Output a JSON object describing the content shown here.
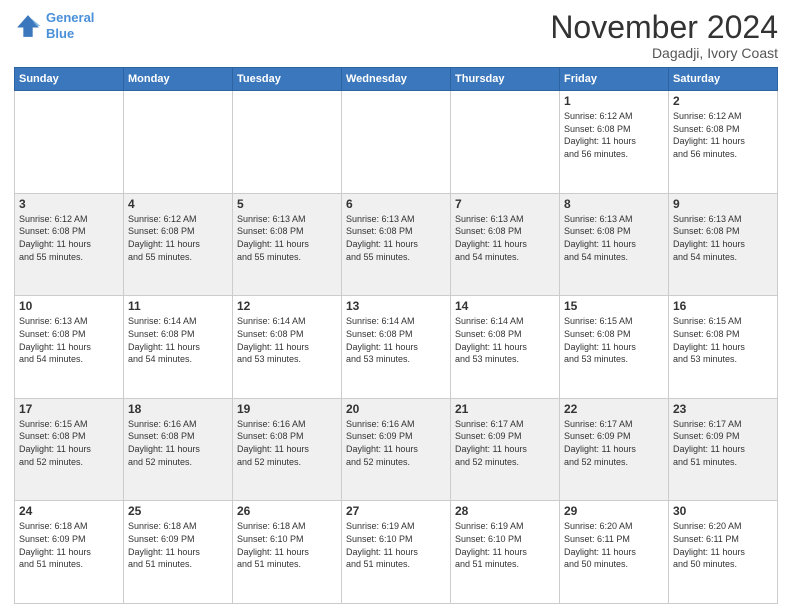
{
  "logo": {
    "line1": "General",
    "line2": "Blue"
  },
  "title": "November 2024",
  "subtitle": "Dagadji, Ivory Coast",
  "days_of_week": [
    "Sunday",
    "Monday",
    "Tuesday",
    "Wednesday",
    "Thursday",
    "Friday",
    "Saturday"
  ],
  "weeks": [
    [
      {
        "day": "",
        "info": ""
      },
      {
        "day": "",
        "info": ""
      },
      {
        "day": "",
        "info": ""
      },
      {
        "day": "",
        "info": ""
      },
      {
        "day": "",
        "info": ""
      },
      {
        "day": "1",
        "info": "Sunrise: 6:12 AM\nSunset: 6:08 PM\nDaylight: 11 hours\nand 56 minutes."
      },
      {
        "day": "2",
        "info": "Sunrise: 6:12 AM\nSunset: 6:08 PM\nDaylight: 11 hours\nand 56 minutes."
      }
    ],
    [
      {
        "day": "3",
        "info": "Sunrise: 6:12 AM\nSunset: 6:08 PM\nDaylight: 11 hours\nand 55 minutes."
      },
      {
        "day": "4",
        "info": "Sunrise: 6:12 AM\nSunset: 6:08 PM\nDaylight: 11 hours\nand 55 minutes."
      },
      {
        "day": "5",
        "info": "Sunrise: 6:13 AM\nSunset: 6:08 PM\nDaylight: 11 hours\nand 55 minutes."
      },
      {
        "day": "6",
        "info": "Sunrise: 6:13 AM\nSunset: 6:08 PM\nDaylight: 11 hours\nand 55 minutes."
      },
      {
        "day": "7",
        "info": "Sunrise: 6:13 AM\nSunset: 6:08 PM\nDaylight: 11 hours\nand 54 minutes."
      },
      {
        "day": "8",
        "info": "Sunrise: 6:13 AM\nSunset: 6:08 PM\nDaylight: 11 hours\nand 54 minutes."
      },
      {
        "day": "9",
        "info": "Sunrise: 6:13 AM\nSunset: 6:08 PM\nDaylight: 11 hours\nand 54 minutes."
      }
    ],
    [
      {
        "day": "10",
        "info": "Sunrise: 6:13 AM\nSunset: 6:08 PM\nDaylight: 11 hours\nand 54 minutes."
      },
      {
        "day": "11",
        "info": "Sunrise: 6:14 AM\nSunset: 6:08 PM\nDaylight: 11 hours\nand 54 minutes."
      },
      {
        "day": "12",
        "info": "Sunrise: 6:14 AM\nSunset: 6:08 PM\nDaylight: 11 hours\nand 53 minutes."
      },
      {
        "day": "13",
        "info": "Sunrise: 6:14 AM\nSunset: 6:08 PM\nDaylight: 11 hours\nand 53 minutes."
      },
      {
        "day": "14",
        "info": "Sunrise: 6:14 AM\nSunset: 6:08 PM\nDaylight: 11 hours\nand 53 minutes."
      },
      {
        "day": "15",
        "info": "Sunrise: 6:15 AM\nSunset: 6:08 PM\nDaylight: 11 hours\nand 53 minutes."
      },
      {
        "day": "16",
        "info": "Sunrise: 6:15 AM\nSunset: 6:08 PM\nDaylight: 11 hours\nand 53 minutes."
      }
    ],
    [
      {
        "day": "17",
        "info": "Sunrise: 6:15 AM\nSunset: 6:08 PM\nDaylight: 11 hours\nand 52 minutes."
      },
      {
        "day": "18",
        "info": "Sunrise: 6:16 AM\nSunset: 6:08 PM\nDaylight: 11 hours\nand 52 minutes."
      },
      {
        "day": "19",
        "info": "Sunrise: 6:16 AM\nSunset: 6:08 PM\nDaylight: 11 hours\nand 52 minutes."
      },
      {
        "day": "20",
        "info": "Sunrise: 6:16 AM\nSunset: 6:09 PM\nDaylight: 11 hours\nand 52 minutes."
      },
      {
        "day": "21",
        "info": "Sunrise: 6:17 AM\nSunset: 6:09 PM\nDaylight: 11 hours\nand 52 minutes."
      },
      {
        "day": "22",
        "info": "Sunrise: 6:17 AM\nSunset: 6:09 PM\nDaylight: 11 hours\nand 52 minutes."
      },
      {
        "day": "23",
        "info": "Sunrise: 6:17 AM\nSunset: 6:09 PM\nDaylight: 11 hours\nand 51 minutes."
      }
    ],
    [
      {
        "day": "24",
        "info": "Sunrise: 6:18 AM\nSunset: 6:09 PM\nDaylight: 11 hours\nand 51 minutes."
      },
      {
        "day": "25",
        "info": "Sunrise: 6:18 AM\nSunset: 6:09 PM\nDaylight: 11 hours\nand 51 minutes."
      },
      {
        "day": "26",
        "info": "Sunrise: 6:18 AM\nSunset: 6:10 PM\nDaylight: 11 hours\nand 51 minutes."
      },
      {
        "day": "27",
        "info": "Sunrise: 6:19 AM\nSunset: 6:10 PM\nDaylight: 11 hours\nand 51 minutes."
      },
      {
        "day": "28",
        "info": "Sunrise: 6:19 AM\nSunset: 6:10 PM\nDaylight: 11 hours\nand 51 minutes."
      },
      {
        "day": "29",
        "info": "Sunrise: 6:20 AM\nSunset: 6:11 PM\nDaylight: 11 hours\nand 50 minutes."
      },
      {
        "day": "30",
        "info": "Sunrise: 6:20 AM\nSunset: 6:11 PM\nDaylight: 11 hours\nand 50 minutes."
      }
    ]
  ]
}
